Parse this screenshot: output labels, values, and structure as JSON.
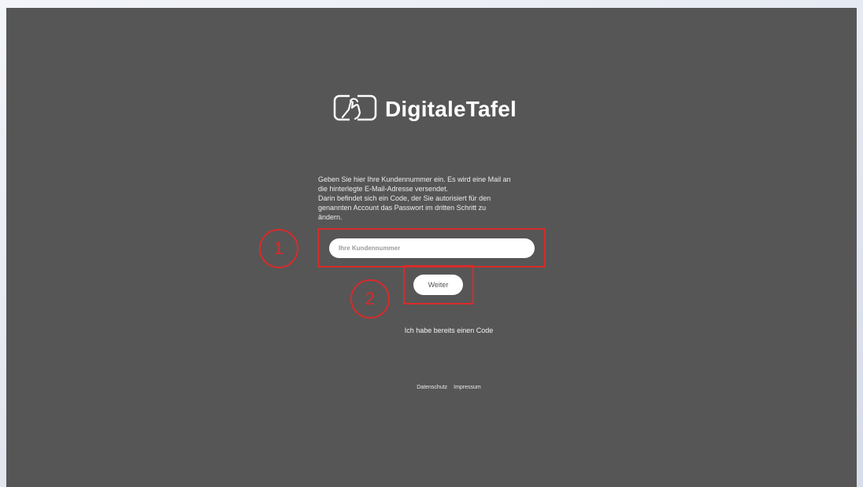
{
  "brand": {
    "name": "DigitaleTafel",
    "logo_icon": "hand-touch-tablet-icon"
  },
  "intro": {
    "lines": [
      "Geben Sie hier Ihre Kundennummer ein. Es wird eine Mail an",
      "die hinterlegte E-Mail-Adresse versendet.",
      "Darin befindet sich ein Code, der Sie autorisiert für den",
      "genannten Account das Passwort im dritten Schritt zu",
      "ändern."
    ]
  },
  "form": {
    "customer_number_placeholder": "Ihre Kundennummer",
    "customer_number_value": "",
    "submit_label": "Weiter"
  },
  "links": {
    "have_code": "Ich habe bereits einen Code"
  },
  "footer": {
    "privacy": "Datenschutz",
    "imprint": "Impressum"
  },
  "annotations": {
    "step1": "1",
    "step2": "2",
    "color": "#d92a2a"
  },
  "colors": {
    "panel_background": "#565656",
    "text": "#ffffff"
  }
}
